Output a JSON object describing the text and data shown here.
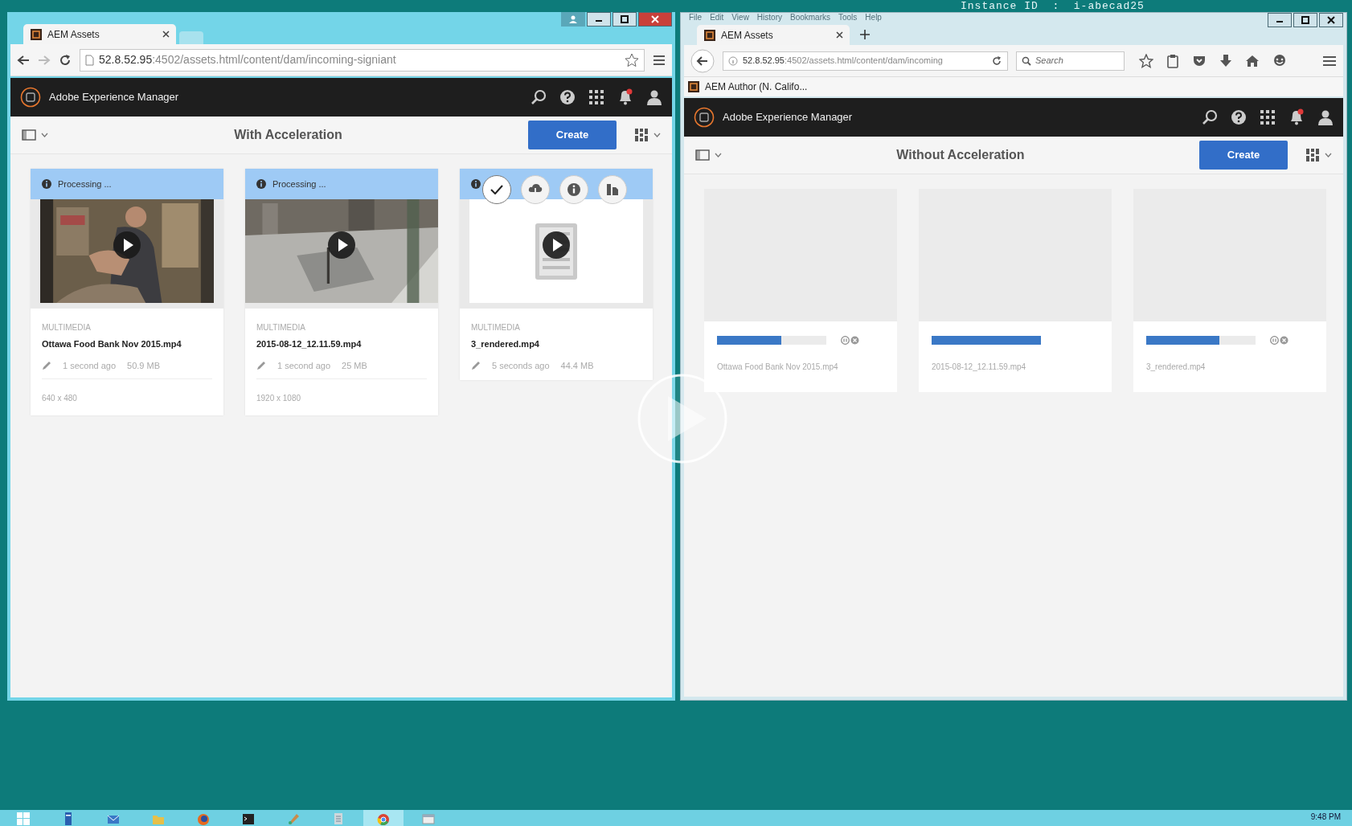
{
  "overlay_banner": {
    "text": "Instance ID  :  i-abecad25"
  },
  "windows": [
    {
      "kind": "chrome",
      "tabs": [
        {
          "title": "AEM Assets",
          "selected": true
        }
      ],
      "url_host": "52.8.52.95",
      "url_path": ":4502/assets.html/content/dam/incoming-signiant",
      "app_title": "Adobe Experience Manager",
      "folder_title": "With Acceleration",
      "create_label": "Create",
      "cards": [
        {
          "kind": "processing",
          "status": "Processing ...",
          "hovered": false,
          "type": "MULTIMEDIA",
          "name": "Ottawa Food Bank Nov 2015.mp4",
          "modified": "1 second ago",
          "size": "50.9 MB",
          "dimensions": "640 x 480"
        },
        {
          "kind": "processing",
          "status": "Processing ...",
          "hovered": false,
          "type": "MULTIMEDIA",
          "name": "2015-08-12_12.11.59.mp4",
          "modified": "1 second ago",
          "size": "25 MB",
          "dimensions": "1920 x 1080"
        },
        {
          "kind": "processing",
          "thumbnail": {
            "kind": "document"
          },
          "hovered": true,
          "type": "MULTIMEDIA",
          "name": "3_rendered.mp4",
          "modified": "5 seconds ago",
          "size": "44.4 MB"
        }
      ]
    },
    {
      "kind": "firefox",
      "menu": [
        "File",
        "Edit",
        "View",
        "History",
        "Bookmarks",
        "Tools",
        "Help"
      ],
      "tabs": [
        {
          "title": "AEM Assets",
          "selected": true
        }
      ],
      "url_host": "52.8.52.95",
      "url_path": ":4502/assets.html/content/dam/incoming",
      "search_placeholder": "Search",
      "bookmarks": [
        "AEM Author (N. Califo..."
      ],
      "app_title": "Adobe Experience Manager",
      "folder_title": "Without Acceleration",
      "create_label": "Create",
      "cards": [
        {
          "kind": "uploading",
          "level": 0.59,
          "controls": true,
          "name": "Ottawa Food Bank Nov 2015.mp4"
        },
        {
          "kind": "uploading",
          "level": 1.0,
          "controls": false,
          "name": "2015-08-12_12.11.59.mp4"
        },
        {
          "kind": "uploading",
          "level": 0.67,
          "controls": true,
          "name": "3_rendered.mp4"
        }
      ]
    }
  ],
  "taskbar": {
    "apps": [
      {
        "kind": "start",
        "selected": false
      },
      {
        "kind": "server",
        "selected": false
      },
      {
        "kind": "mail",
        "selected": false
      },
      {
        "kind": "folder",
        "selected": false
      },
      {
        "kind": "firefox",
        "selected": false
      },
      {
        "kind": "terminal",
        "selected": false
      },
      {
        "kind": "paint",
        "selected": false
      },
      {
        "kind": "notepad",
        "selected": false
      },
      {
        "kind": "chrome",
        "selected": true
      },
      {
        "kind": "window",
        "selected": false
      }
    ],
    "time": "9:48 PM"
  }
}
